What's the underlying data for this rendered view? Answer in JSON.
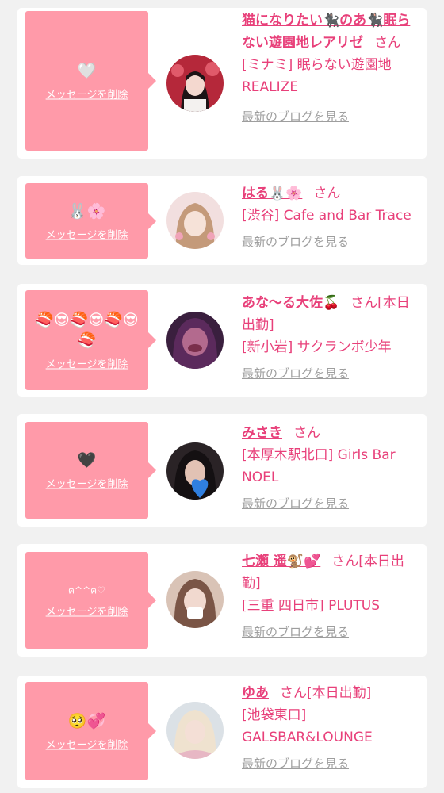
{
  "delete_label": "メッセージを削除",
  "blog_label": "最新のブログを見る",
  "san_label": "さん",
  "cards": [
    {
      "message": "🤍",
      "name": "猫になりたい🐈‍⬛のあ🐈‍⬛眠らない遊園地レアリゼ",
      "suffix": "",
      "shop": "[ミナミ] 眠らない遊園地REALIZE"
    },
    {
      "message": "🐰🌸",
      "name": "はる🐰🌸",
      "suffix": "",
      "shop": "[渋谷] Cafe and Bar Trace"
    },
    {
      "message": "🍣😎🍣😎🍣😎🍣",
      "name": "あな〜る大佐🍒",
      "suffix": "[本日出勤]",
      "shop": "[新小岩] サクランボ少年"
    },
    {
      "message": "🖤",
      "name": "みさき",
      "suffix": "",
      "shop": "[本厚木駅北口] Girls Bar NOEL"
    },
    {
      "message": "ฅ^^ฅ♡",
      "name": "七瀬 遥🐒💕",
      "suffix": "[本日出勤]",
      "shop": "[三重 四日市] PLUTUS"
    },
    {
      "message": "🥺💞",
      "name": "ゆあ",
      "suffix": "[本日出勤]",
      "shop": "[池袋東口] GALSBAR&LOUNGE"
    }
  ]
}
